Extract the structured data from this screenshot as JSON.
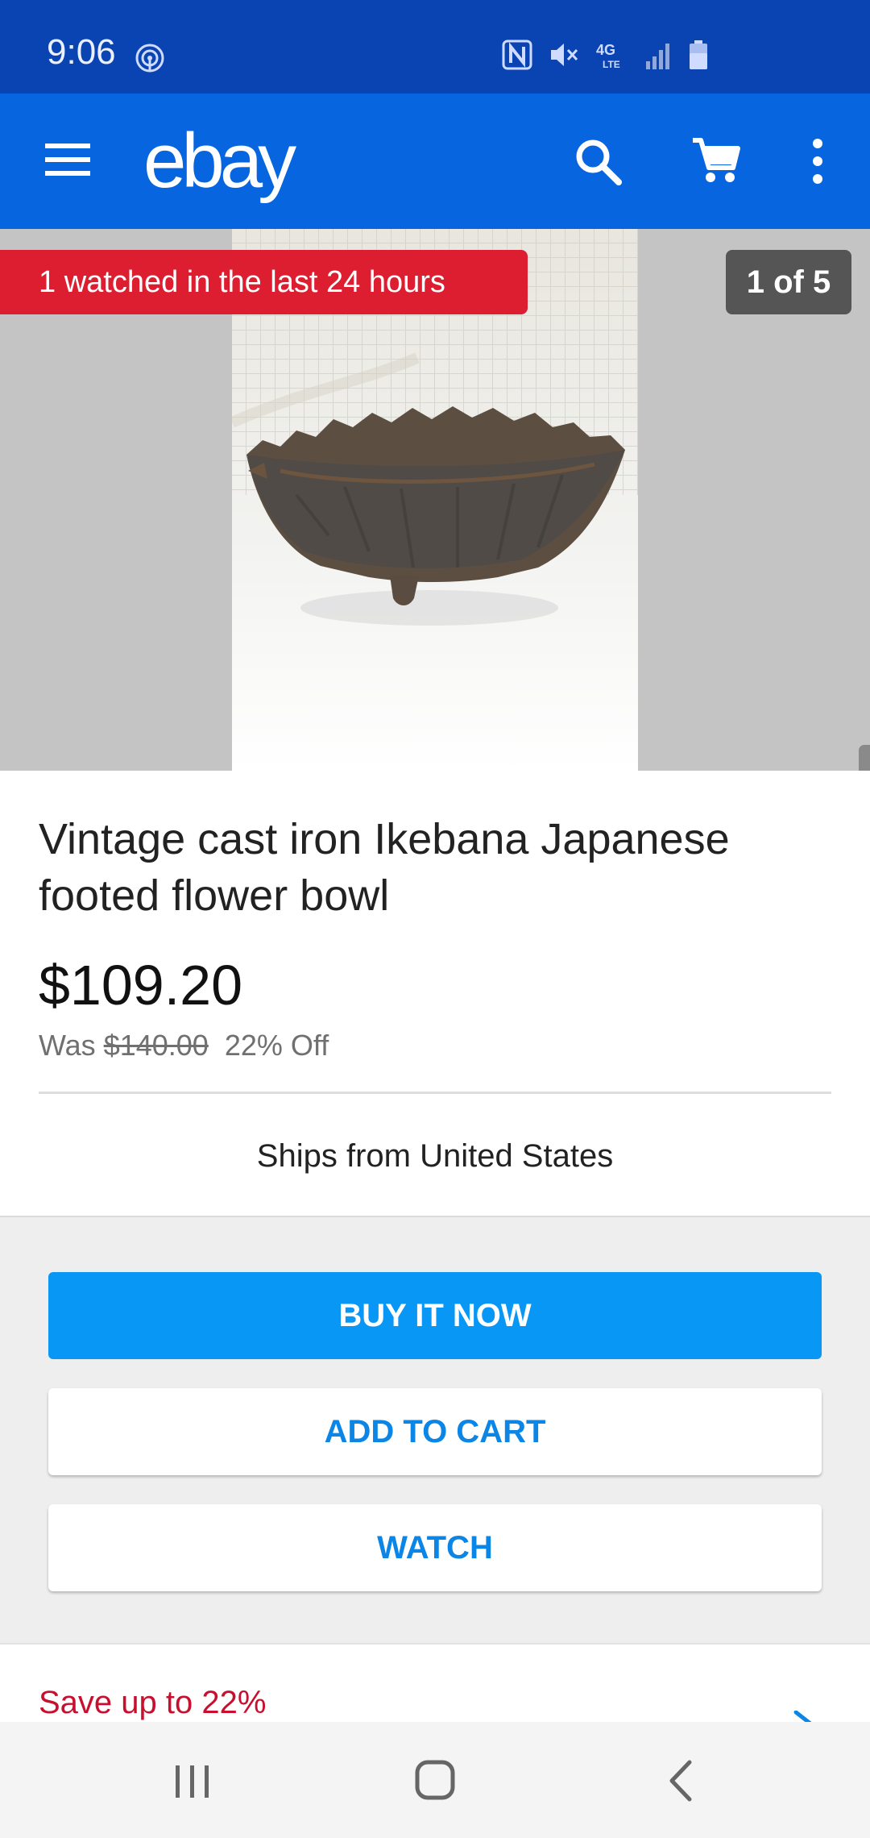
{
  "status_bar": {
    "time": "9:06",
    "icons": [
      "hotspot-icon",
      "nfc-icon",
      "mute-icon",
      "4g-lte-icon",
      "signal-icon",
      "battery-icon"
    ]
  },
  "app_bar": {
    "logo": "ebay",
    "icons": [
      "menu-icon",
      "search-icon",
      "cart-icon",
      "more-vert-icon"
    ]
  },
  "gallery": {
    "watched_badge": "1 watched in the last 24 hours",
    "counter": "1 of 5"
  },
  "listing": {
    "title": "Vintage cast iron Ikebana Japanese footed flower bowl",
    "price": "$109.20",
    "was_label": "Was",
    "was_price": "$140.00",
    "discount": "22% Off",
    "ships_from": "Ships from United States"
  },
  "actions": {
    "buy_now": "BUY IT NOW",
    "add_to_cart": "ADD TO CART",
    "watch": "WATCH"
  },
  "promo": {
    "save_text": "Save up to 22%"
  },
  "colors": {
    "status_bar": "#0a44b3",
    "app_bar": "#0765df",
    "buy_button": "#0897f4",
    "secondary_button_text": "#0b86e6",
    "watched_badge": "#dd1e31",
    "save_text": "#c8102e"
  }
}
